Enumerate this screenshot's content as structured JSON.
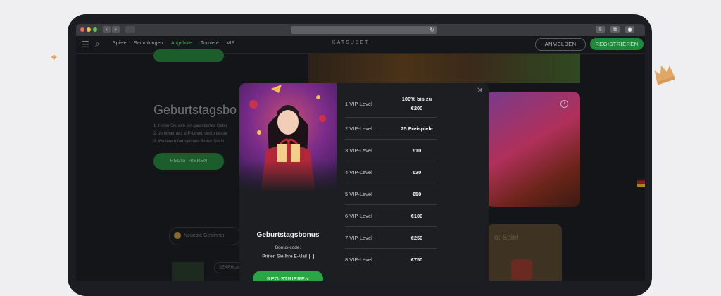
{
  "browser": {
    "back_glyph": "‹",
    "forward_glyph": "›",
    "reload_glyph": "↻",
    "traffic_colors": [
      "#ed6a5e",
      "#f4bf4f",
      "#61c554"
    ],
    "share_glyph": "⇪",
    "tabs_glyph": "⧉",
    "ext_glyph": "●"
  },
  "site": {
    "menu_glyph": "☰",
    "search_glyph": "⌕",
    "nav": [
      "Spiele",
      "Sammlungen",
      "Angebote",
      "Turniere",
      "VIP"
    ],
    "logo": "KATSUBET",
    "login_label": "ANMELDEN",
    "register_label": "REGISTRIEREN",
    "accent": "#1f8a3c"
  },
  "background": {
    "title": "Geburtstagsbo",
    "list": [
      "1. Holen Sie sich ein garantiertes Gebu",
      "2. Je höher das VIP-Level, desto besse",
      "3. Weitere Informationen finden Sie in"
    ],
    "register_label": "REGISTRIEREN",
    "pill_label": "Neueste Gewinner",
    "chip_label": "SEARHLA",
    "card_title": "ot-Spiel",
    "info_glyph": "i"
  },
  "modal": {
    "close_glyph": "×",
    "title": "Geburtstagsbonus",
    "bonus_code_label": "Bonus-code:",
    "bonus_code_value": "Prüfen Sie Ihre E-Mail",
    "register_label": "REGISTRIEREN",
    "rows": [
      {
        "level": "1 VIP-Level",
        "reward": "100% bis zu €200"
      },
      {
        "level": "2 VIP-Level",
        "reward": "25 Freispiele"
      },
      {
        "level": "3 VIP-Level",
        "reward": "€10"
      },
      {
        "level": "4 VIP-Level",
        "reward": "€30"
      },
      {
        "level": "5 VIP-Level",
        "reward": "€50"
      },
      {
        "level": "6 VIP-Level",
        "reward": "€100"
      },
      {
        "level": "7 VIP-Level",
        "reward": "€250"
      },
      {
        "level": "8 VIP-Level",
        "reward": "€750"
      }
    ]
  },
  "decor": {
    "sparkle_glyph": "✦",
    "crown_color": "#e2a765"
  }
}
